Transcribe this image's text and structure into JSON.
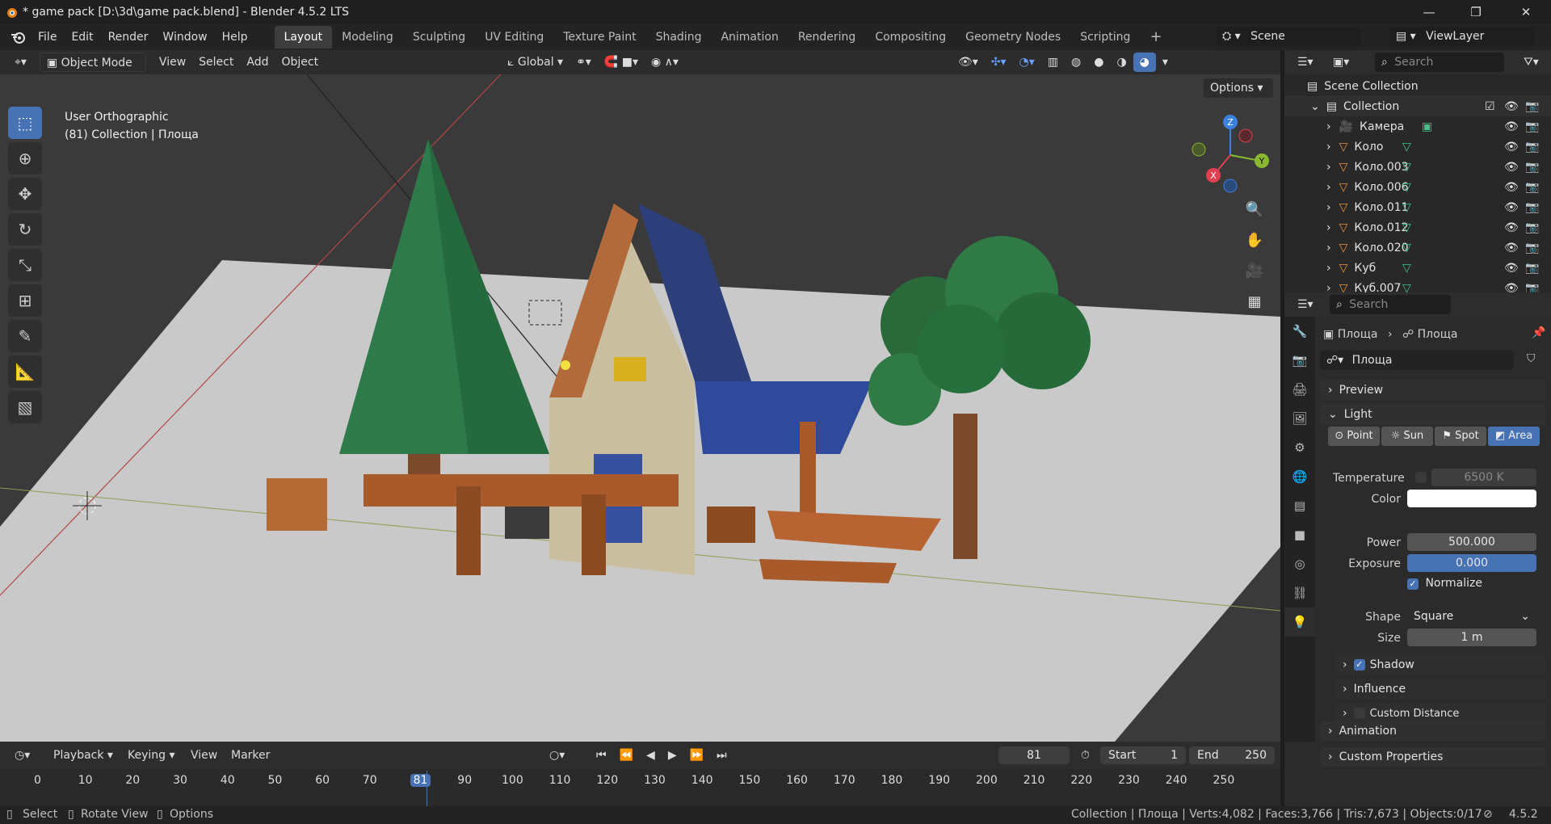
{
  "window": {
    "title": "* game pack [D:\\3d\\game pack.blend] - Blender 4.5.2 LTS",
    "minimize": "—",
    "maximize": "❐",
    "close": "✕"
  },
  "menu": [
    "File",
    "Edit",
    "Render",
    "Window",
    "Help"
  ],
  "workspaces": [
    "Layout",
    "Modeling",
    "Sculpting",
    "UV Editing",
    "Texture Paint",
    "Shading",
    "Animation",
    "Rendering",
    "Compositing",
    "Geometry Nodes",
    "Scripting"
  ],
  "active_workspace": "Layout",
  "scene": {
    "name": "Scene",
    "view_layer": "ViewLayer"
  },
  "viewport_header": {
    "mode": "Object Mode",
    "menus": [
      "View",
      "Select",
      "Add",
      "Object"
    ],
    "orientation": "Global",
    "options": "Options"
  },
  "viewport_info": {
    "view": "User Orthographic",
    "collection": "(81) Collection | Площа"
  },
  "gizmo": {
    "x": "X",
    "y": "Y",
    "z": "Z"
  },
  "outliner": {
    "search_placeholder": "Search",
    "scene_collection": "Scene Collection",
    "collection": "Collection",
    "items": [
      "Камера",
      "Коло",
      "Коло.003",
      "Коло.006",
      "Коло.011",
      "Коло.012",
      "Коло.020",
      "Куб",
      "Куб.007"
    ]
  },
  "properties": {
    "search_placeholder": "Search",
    "breadcrumb_object": "Площа",
    "breadcrumb_data": "Площа",
    "data_name": "Площа",
    "sections": {
      "preview": "Preview",
      "light": "Light",
      "shadow": "Shadow",
      "influence": "Influence",
      "custom_distance": "Custom Distance",
      "animation": "Animation",
      "custom_properties": "Custom Properties"
    },
    "light_types": [
      "Point",
      "Sun",
      "Spot",
      "Area"
    ],
    "active_light_type": "Area",
    "temperature_label": "Temperature",
    "temperature": "6500 K",
    "color_label": "Color",
    "color": "#ffffff",
    "power_label": "Power",
    "power": "500.000",
    "exposure_label": "Exposure",
    "exposure": "0.000",
    "normalize": "Normalize",
    "shape_label": "Shape",
    "shape": "Square",
    "size_label": "Size",
    "size": "1 m"
  },
  "timeline": {
    "menus": [
      "Playback",
      "Keying",
      "View",
      "Marker"
    ],
    "current_frame": "81",
    "start_label": "Start",
    "start": "1",
    "end_label": "End",
    "end": "250",
    "ticks": [
      "0",
      "10",
      "20",
      "30",
      "40",
      "50",
      "60",
      "70",
      "81",
      "90",
      "100",
      "110",
      "120",
      "130",
      "140",
      "150",
      "160",
      "170",
      "180",
      "190",
      "200",
      "210",
      "220",
      "230",
      "240",
      "250"
    ]
  },
  "status": {
    "select": "Select",
    "rotate": "Rotate View",
    "options": "Options",
    "stats": "Collection | Площа | Verts:4,082 | Faces:3,766 | Tris:7,673 | Objects:0/17",
    "version": "4.5.2"
  }
}
